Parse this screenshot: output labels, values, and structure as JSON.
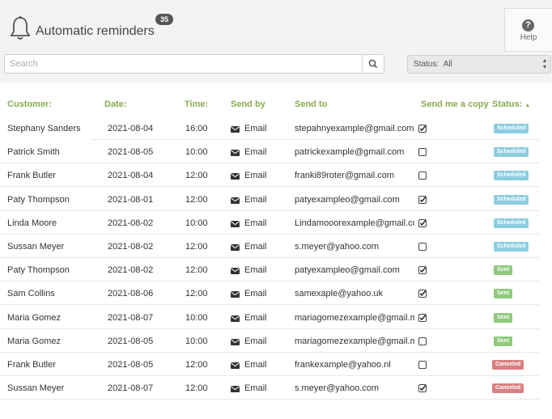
{
  "header": {
    "title": "Automatic reminders",
    "badge_count": "35",
    "help_label": "Help"
  },
  "search": {
    "placeholder": "Search",
    "value": ""
  },
  "status_filter": {
    "label": "Status:",
    "selected": "All"
  },
  "table": {
    "columns": {
      "customer": "Customer:",
      "date": "Date:",
      "time": "Time:",
      "send_by": "Send by",
      "send_to": "Send to",
      "copy": "Send me a copy",
      "status": "Status:",
      "status_sort": "▲"
    },
    "rows": [
      {
        "customer": "Stephany Sanders",
        "date": "2021-08-04",
        "time": "16:00",
        "send_by": "Email",
        "send_to": "stepahnyexample@gmail.com",
        "copy": true,
        "status": "Scheduled"
      },
      {
        "customer": "Patrick Smith",
        "date": "2021-08-05",
        "time": "10:00",
        "send_by": "Email",
        "send_to": "patrickexample@gmail.com",
        "copy": false,
        "status": "Scheduled"
      },
      {
        "customer": "Frank Butler",
        "date": "2021-08-04",
        "time": "12:00",
        "send_by": "Email",
        "send_to": "franki89roter@gmail.com",
        "copy": false,
        "status": "Scheduled"
      },
      {
        "customer": "Paty Thompson",
        "date": "2021-08-01",
        "time": "12:00",
        "send_by": "Email",
        "send_to": "patyexampleo@gmail.com",
        "copy": true,
        "status": "Scheduled"
      },
      {
        "customer": "Linda Moore",
        "date": "2021-08-02",
        "time": "10:00",
        "send_by": "Email",
        "send_to": "Lindamooorexample@gmail.com",
        "copy": true,
        "status": "Scheduled"
      },
      {
        "customer": "Sussan Meyer",
        "date": "2021-08-02",
        "time": "12:00",
        "send_by": "Email",
        "send_to": "s.meyer@yahoo.com",
        "copy": false,
        "status": "Scheduled"
      },
      {
        "customer": "Paty Thompson",
        "date": "2021-08-02",
        "time": "12:00",
        "send_by": "Email",
        "send_to": "patyexampleo@gmail.com",
        "copy": true,
        "status": "Sent"
      },
      {
        "customer": "Sam Collins",
        "date": "2021-08-06",
        "time": "12:00",
        "send_by": "Email",
        "send_to": "samexaple@yahoo.uk",
        "copy": true,
        "status": "Sent"
      },
      {
        "customer": "Maria Gomez",
        "date": "2021-08-07",
        "time": "10:00",
        "send_by": "Email",
        "send_to": "mariagomezexample@gmail.mx",
        "copy": true,
        "status": "Sent"
      },
      {
        "customer": "Maria Gomez",
        "date": "2021-08-05",
        "time": "10:00",
        "send_by": "Email",
        "send_to": "mariagomezexample@gmail.mx",
        "copy": false,
        "status": "Sent"
      },
      {
        "customer": "Frank Butler",
        "date": "2021-08-05",
        "time": "12:00",
        "send_by": "Email",
        "send_to": "frankexample@yahoo.nl",
        "copy": false,
        "status": "Canceled"
      },
      {
        "customer": "Sussan Meyer",
        "date": "2021-08-07",
        "time": "12:00",
        "send_by": "Email",
        "send_to": "s.meyer@yahoo.com",
        "copy": true,
        "status": "Canceled"
      }
    ]
  },
  "icons": {
    "header": "bell-icon",
    "help": "help-circle-icon",
    "search": "search-icon",
    "send_by": "envelope-icon",
    "copy_checked": "checkbox-checked-icon",
    "copy_unchecked": "checkbox-unchecked-icon"
  },
  "colors": {
    "header_text": "#8aa951",
    "scheduled": "#8dcde0",
    "sent": "#8fc97d",
    "canceled": "#d98080"
  }
}
